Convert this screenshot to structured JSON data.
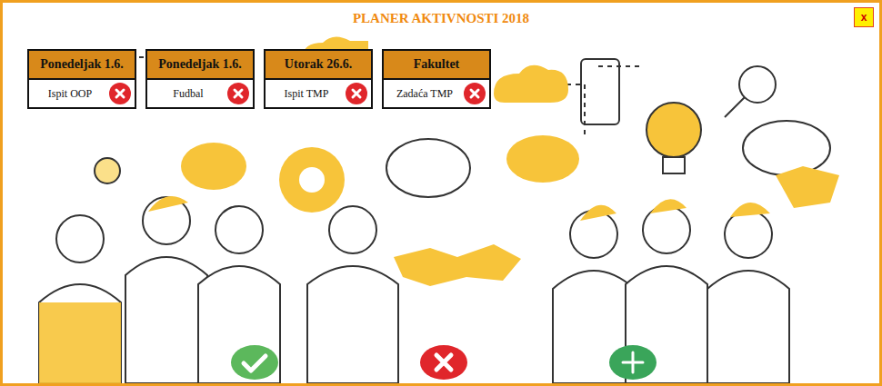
{
  "window": {
    "title": "PLANER AKTIVNOSTI 2018",
    "close": "x"
  },
  "activities": [
    {
      "day": "Ponedeljak 1.6.",
      "name": "Ispit OOP"
    },
    {
      "day": "Ponedeljak 1.6.",
      "name": "Fudbal"
    },
    {
      "day": "Utorak 26.6.",
      "name": "Ispit TMP"
    },
    {
      "day": "Fakultet",
      "name": "Zadaća TMP"
    }
  ]
}
